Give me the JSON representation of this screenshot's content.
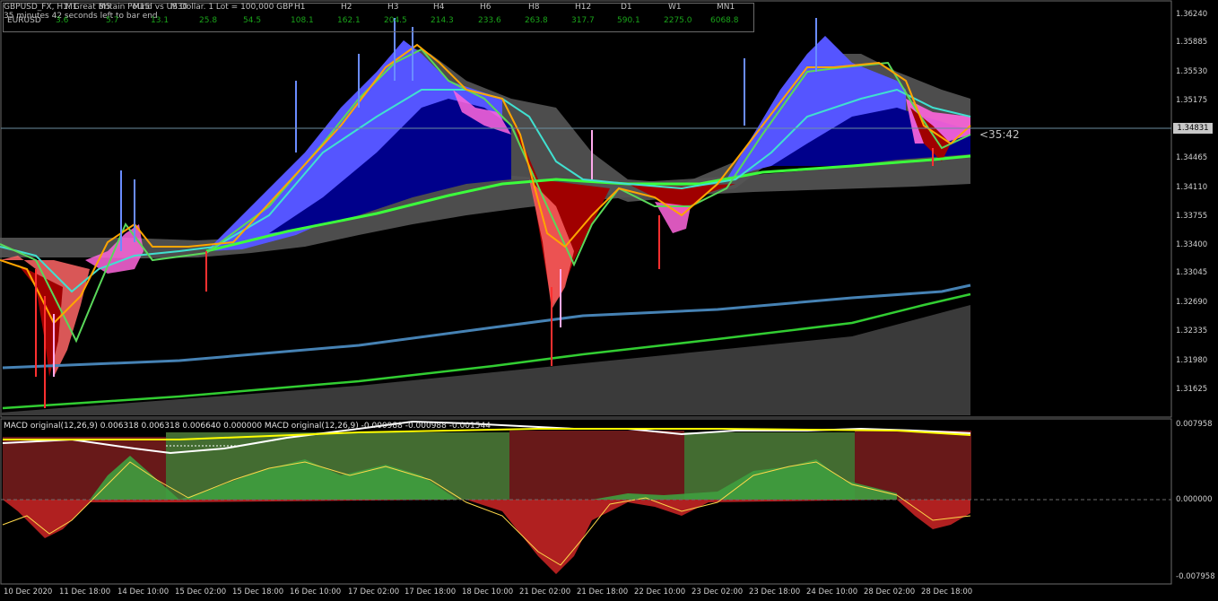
{
  "window": {
    "title": "GBPUSD_FX, H1: Great Britain Pound vs US Dollar. 1 Lot = 100,000 GBP",
    "timer": "35 minutes 42 seconds left to bar end",
    "countdown": "<35:42"
  },
  "timeframe_table": {
    "symbol": "EURUSD",
    "headers": [
      "M1",
      "M5",
      "M15",
      "M30",
      "H1",
      "H2",
      "H3",
      "H4",
      "H6",
      "H8",
      "H12",
      "D1",
      "W1",
      "MN1"
    ],
    "values": [
      "3.6",
      "5.7",
      "13.1",
      "25.8",
      "54.5",
      "108.1",
      "162.1",
      "204.5",
      "214.3",
      "233.6",
      "263.8",
      "317.7",
      "590.1",
      "2275.0",
      "6068.8"
    ]
  },
  "price_axis": {
    "labels": [
      "1.36240",
      "1.35885",
      "1.35530",
      "1.35175",
      "1.34465",
      "1.34110",
      "1.33755",
      "1.33400",
      "1.33045",
      "1.32690",
      "1.32335",
      "1.31980",
      "1.31625"
    ],
    "current_price": "1.34831"
  },
  "macd": {
    "label": "MACD original(12,26,9) 0.006318 0.006318 0.006640 0.000000 MACD original(12,26,9) -0.000988 -0.000988 -0.001544",
    "axis_labels": [
      "0.007958",
      "0.000000",
      "-0.007958"
    ]
  },
  "time_axis": {
    "labels": [
      "10 Dec 2020",
      "11 Dec 18:00",
      "14 Dec 10:00",
      "15 Dec 02:00",
      "15 Dec 18:00",
      "16 Dec 10:00",
      "17 Dec 02:00",
      "17 Dec 18:00",
      "18 Dec 10:00",
      "21 Dec 02:00",
      "21 Dec 18:00",
      "22 Dec 10:00",
      "23 Dec 02:00",
      "23 Dec 18:00",
      "24 Dec 10:00",
      "28 Dec 02:00",
      "28 Dec 18:00"
    ]
  },
  "colors": {
    "background": "#000000",
    "ribbon_blue": "#5555ff",
    "ribbon_navy": "#00008b",
    "ribbon_red": "#a00000",
    "ribbon_pink": "#ff66dd",
    "ma_blue": "#4682b4",
    "ma_green": "#32cd32",
    "hist_green": "#5a8f3a",
    "hist_red": "#a52a2a",
    "signal_yellow": "#ffff00"
  }
}
